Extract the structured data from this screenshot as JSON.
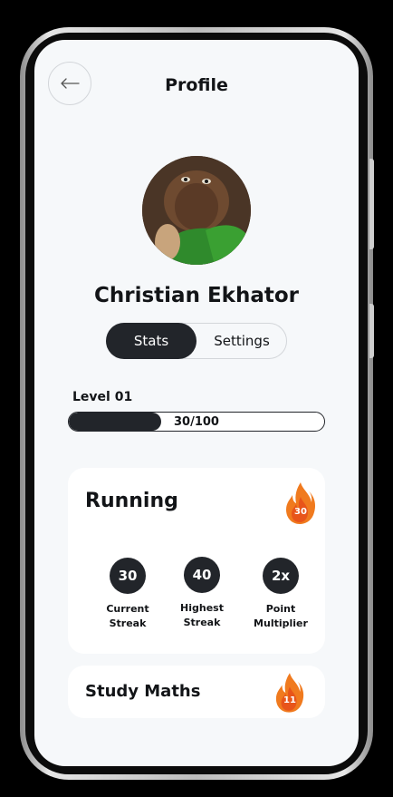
{
  "header": {
    "title": "Profile",
    "back_icon": "arrow-left-icon"
  },
  "profile": {
    "name": "Christian Ekhator",
    "avatar": "profile-photo"
  },
  "tabs": [
    {
      "label": "Stats",
      "active": true
    },
    {
      "label": "Settings",
      "active": false
    }
  ],
  "level": {
    "label": "Level 01",
    "progress_text": "30/100",
    "progress": 0.3
  },
  "habits": [
    {
      "name": "Running",
      "streak_badge": "30",
      "stats": [
        {
          "value": "30",
          "label_line1": "Current",
          "label_line2": "Streak"
        },
        {
          "value": "40",
          "label_line1": "Highest",
          "label_line2": "Streak"
        },
        {
          "value": "2x",
          "label_line1": "Point",
          "label_line2": "Multiplier"
        }
      ]
    },
    {
      "name": "Study Maths",
      "streak_badge": "11"
    }
  ],
  "colors": {
    "dark": "#22252a",
    "background": "#f6f8fa",
    "flame_orange": "#f07a1e"
  }
}
